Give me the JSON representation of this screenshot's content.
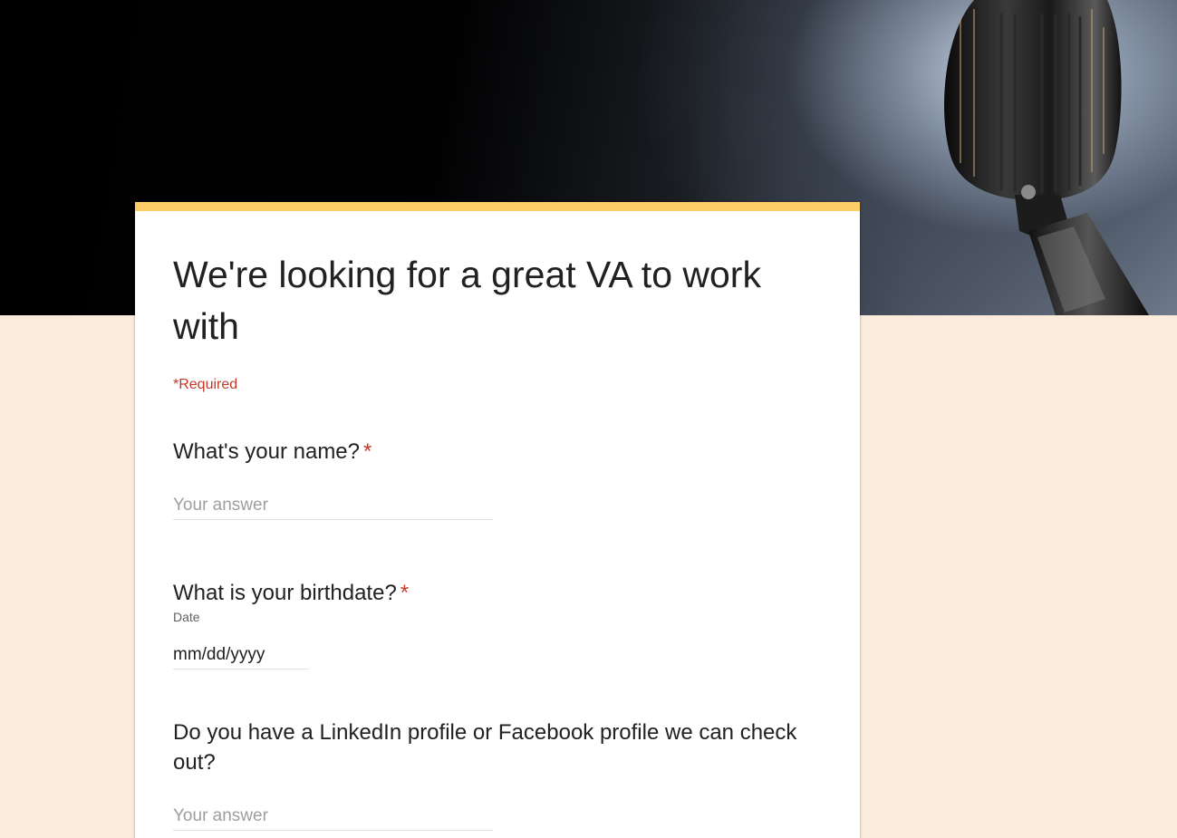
{
  "form": {
    "title": "We're looking for a great VA to work with",
    "required_note": "*Required",
    "accent_color": "#ffcc66",
    "background_color": "#faebdc",
    "header_image": "vintage-microphone-image",
    "questions": [
      {
        "title": "What's your name?",
        "required_mark": "*",
        "placeholder": "Your answer"
      },
      {
        "title": "What is your birthdate?",
        "required_mark": "*",
        "subtitle": "Date",
        "placeholder": "mm/dd/yyyy"
      },
      {
        "title": "Do you have a LinkedIn profile or Facebook profile we can check out?",
        "placeholder": "Your answer"
      }
    ]
  }
}
